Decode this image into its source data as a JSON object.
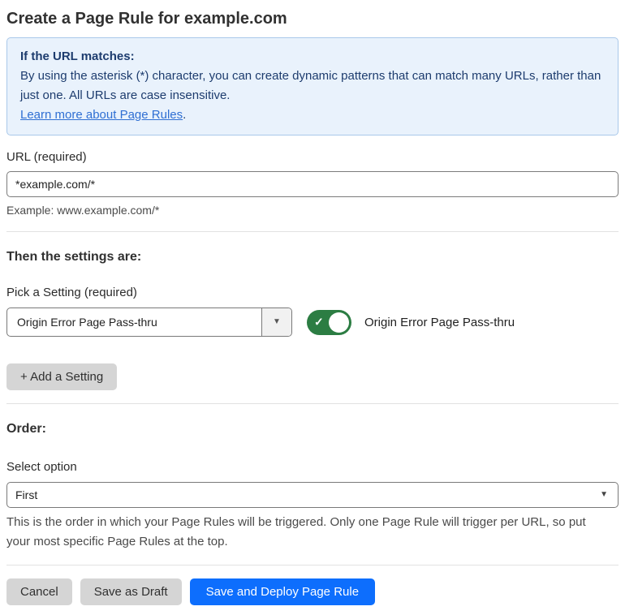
{
  "page": {
    "title": "Create a Page Rule for example.com"
  },
  "info_box": {
    "heading": "If the URL matches:",
    "body": "By using the asterisk (*) character, you can create dynamic patterns that can match many URLs, rather than just one. All URLs are case insensitive.",
    "link_label": "Learn more about Page Rules",
    "link_suffix": "."
  },
  "url_field": {
    "label": "URL (required)",
    "value": "*example.com/*",
    "helper": "Example: www.example.com/*"
  },
  "settings_section": {
    "heading": "Then the settings are:",
    "picker_label": "Pick a Setting (required)",
    "picker_value": "Origin Error Page Pass-thru",
    "picker_arrow_icon": "▼",
    "toggle_state": "on",
    "toggle_check_icon": "✓",
    "toggle_label": "Origin Error Page Pass-thru",
    "add_setting_label": "+ Add a Setting"
  },
  "order_section": {
    "heading": "Order:",
    "select_label": "Select option",
    "select_value": "First",
    "select_arrow_icon": "▼",
    "helper": "This is the order in which your Page Rules will be triggered. Only one Page Rule will trigger per URL, so put your most specific Page Rules at the top."
  },
  "footer": {
    "cancel_label": "Cancel",
    "save_draft_label": "Save as Draft",
    "save_deploy_label": "Save and Deploy Page Rule"
  },
  "colors": {
    "info_bg": "#e9f2fc",
    "info_border": "#a9c8ea",
    "info_text": "#1d3c6e",
    "link_blue": "#2f6fd3",
    "toggle_green": "#2c7d43",
    "primary_blue": "#0d6efd",
    "button_gray": "#d5d5d5"
  }
}
